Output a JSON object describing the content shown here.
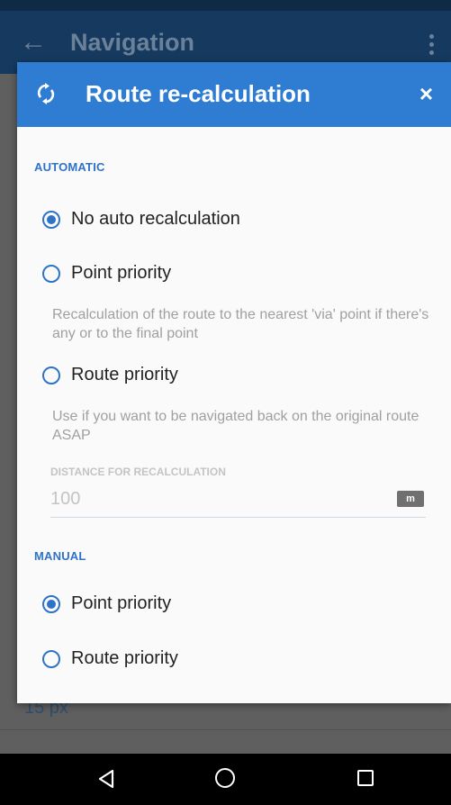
{
  "app": {
    "title": "Navigation",
    "background_value": "15 px"
  },
  "dialog": {
    "title": "Route re-calculation",
    "close_label": "×",
    "automatic": {
      "heading": "AUTOMATIC",
      "options": [
        {
          "label": "No auto recalculation",
          "selected": true
        },
        {
          "label": "Point priority",
          "selected": false,
          "description": "Recalculation of the route to the nearest 'via' point if there's any or to the final point"
        },
        {
          "label": "Route priority",
          "selected": false,
          "description": "Use if you want to be navigated back on the original route ASAP"
        }
      ]
    },
    "distance": {
      "label": "DISTANCE FOR RECALCULATION",
      "value": "100",
      "unit": "m"
    },
    "manual": {
      "heading": "MANUAL",
      "options": [
        {
          "label": "Point priority",
          "selected": true
        },
        {
          "label": "Route priority",
          "selected": false
        }
      ]
    }
  },
  "colors": {
    "accent": "#2f7dd2",
    "appbar": "#163a5f"
  },
  "icons": {
    "appbar_back": "arrow-left-icon",
    "appbar_menu": "overflow-menu-icon",
    "dialog_icon": "refresh-icon",
    "dialog_close": "close-icon",
    "nav": [
      "nav-back-icon",
      "nav-home-icon",
      "nav-recents-icon"
    ]
  }
}
